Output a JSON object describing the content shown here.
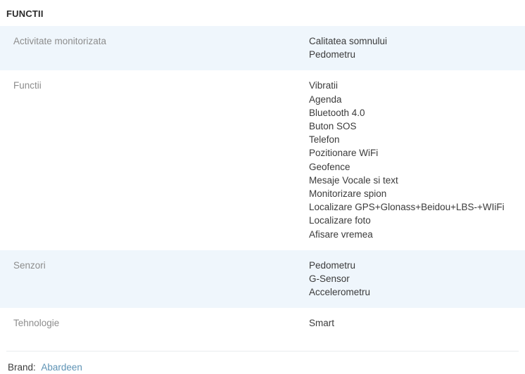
{
  "section": {
    "title": "FUNCTII"
  },
  "spec_rows": [
    {
      "label": "Activitate monitorizata",
      "values": [
        "Calitatea somnului",
        "Pedometru"
      ],
      "shaded": true
    },
    {
      "label": "Functii",
      "values": [
        "Vibratii",
        "Agenda",
        "Bluetooth 4.0",
        "Buton SOS",
        "Telefon",
        "Pozitionare WiFi",
        "Geofence",
        "Mesaje Vocale si text",
        "Monitorizare spion",
        "Localizare GPS+Glonass+Beidou+LBS-+WIiFi",
        "Localizare foto",
        "Afisare vremea"
      ],
      "shaded": false
    },
    {
      "label": "Senzori",
      "values": [
        "Pedometru",
        "G-Sensor",
        "Accelerometru"
      ],
      "shaded": true
    },
    {
      "label": "Tehnologie",
      "values": [
        "Smart"
      ],
      "shaded": false
    }
  ],
  "footer": {
    "brand_label": "Brand:",
    "brand_name": "Abardeen"
  },
  "colors": {
    "row_shaded_bg": "#eff6fc",
    "label_text": "#8d8d8d",
    "value_text": "#3b3b3b",
    "link": "#5e93b5",
    "divider": "#e9ecef",
    "heading": "#2b2b2b"
  }
}
